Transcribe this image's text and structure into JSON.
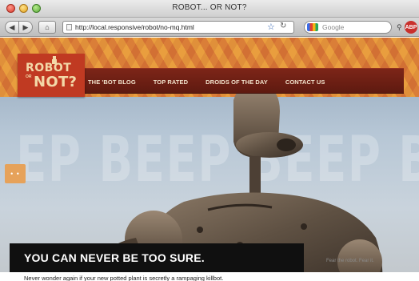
{
  "window": {
    "title": "ROBOT... OR NOT?"
  },
  "toolbar": {
    "back_icon": "back-arrow-icon",
    "forward_icon": "forward-arrow-icon",
    "home_icon": "home-icon",
    "url": "http://local.responsive/robot/no-mq.html",
    "search_placeholder": "Google",
    "search_engine_icon": "google-icon",
    "bookmark_icon": "star-icon",
    "reload_icon": "reload-icon",
    "extension_label": "ABP"
  },
  "site": {
    "logo_line1": "ROBOT",
    "logo_or": "OR",
    "logo_line2": "NOT?",
    "nav": [
      "THE 'BOT BLOG",
      "TOP RATED",
      "DROIDS OF THE DAY",
      "CONTACT US"
    ],
    "hero_background_text": "EP BEEP BEEP BEE",
    "side_tab_label": "• •",
    "caption": "YOU CAN NEVER BE TOO SURE.",
    "credit": "Fear the robot. Fear it.",
    "intro": "Never wonder again if your new potted plant is secretly a rampaging killbot."
  },
  "colors": {
    "nav_bar": "#6e1f14",
    "logo_bg": "#c03a22",
    "accent_orange": "#d98a3c",
    "caption_bg": "#101010"
  }
}
